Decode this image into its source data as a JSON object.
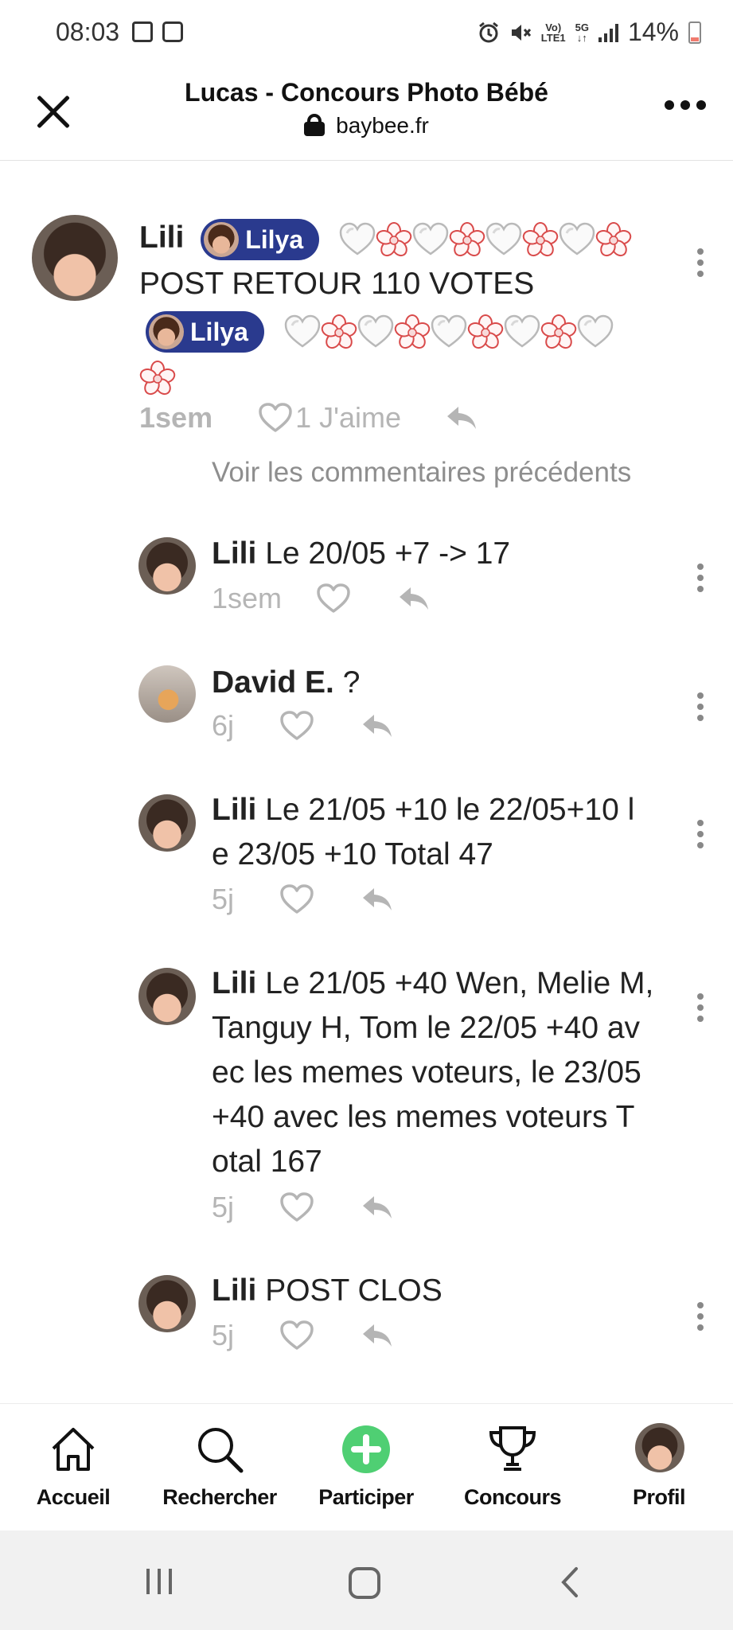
{
  "status_bar": {
    "time": "08:03",
    "lte_top": "Vo)",
    "lte_bottom": "LTE1",
    "net_top": "5G",
    "net_bottom": "↓↑",
    "battery": "14%"
  },
  "header": {
    "title": "Lucas - Concours Photo Bébé",
    "url": "baybee.fr"
  },
  "main_comment": {
    "author": "Lili",
    "tag_1": "Lilya",
    "line_2": "POST RETOUR 110 VOTES",
    "tag_2": "Lilya",
    "time": "1sem",
    "likes": "1 J'aime"
  },
  "previous_comments_link": "Voir les commentaires précédents",
  "replies": [
    {
      "author": "Lili",
      "text": "Le 20/05 +7 -> 17",
      "time": "1sem"
    },
    {
      "author": "David E.",
      "text": "?",
      "time": "6j"
    },
    {
      "author": "Lili",
      "line1": "Le 21/05 +10 le 22/05+10 l",
      "line2": "e 23/05 +10 Total 47",
      "time": "5j"
    },
    {
      "author": "Lili",
      "line1": "Le 21/05 +40 Wen, Melie M,",
      "line2": "Tanguy H, Tom le 22/05 +40 av",
      "line3": "ec les memes voteurs, le 23/05",
      "line4": "+40 avec les memes voteurs T",
      "line5": "otal 167",
      "time": "5j"
    },
    {
      "author": "Lili",
      "text": "POST CLOS",
      "time": "5j"
    }
  ],
  "bottom_nav": {
    "home": "Accueil",
    "search": "Rechercher",
    "participate": "Participer",
    "contests": "Concours",
    "profile": "Profil"
  },
  "colors": {
    "tag_bg": "#2a3a8e",
    "participate_green": "#4fcf73",
    "muted": "#b5b5b5"
  }
}
